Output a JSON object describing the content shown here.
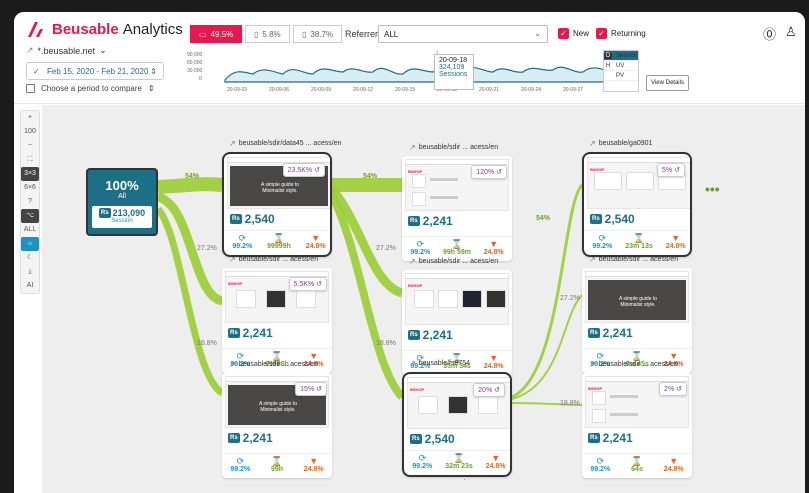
{
  "app": {
    "brand": "Beusable",
    "title": "Analytics"
  },
  "domain": "*.beusable.net",
  "date_range": "Feb 15, 2020 - Feb 21, 2020",
  "compare_label": "Choose a period to compare",
  "devices": [
    {
      "label": "49.5%",
      "active": true
    },
    {
      "label": "5.8%",
      "active": false
    },
    {
      "label": "38.7%",
      "active": false
    }
  ],
  "referrer": {
    "label": "Referrer",
    "value": "ALL"
  },
  "visitor_filters": [
    {
      "label": "New",
      "checked": true
    },
    {
      "label": "Returning",
      "checked": true
    }
  ],
  "spark": {
    "yticks": [
      "90,000",
      "60,000",
      "30,000",
      "0"
    ],
    "xticks": [
      "20-09-03",
      "20-09-06",
      "20-09-09",
      "20-09-12",
      "20-09-15",
      "20-09-18",
      "20-09-21",
      "20-09-24",
      "20-09-27",
      "20-09-30"
    ],
    "tooltip": {
      "date": "20-09-18",
      "value": "324,109",
      "metric": "Sessions"
    }
  },
  "session_menu": [
    {
      "key": "D",
      "label": "Session",
      "active": true
    },
    {
      "key": "H",
      "label": "UV",
      "active": false
    },
    {
      "key": "",
      "label": "PV",
      "active": false
    }
  ],
  "view_details": "View Details",
  "toolbar": [
    "+",
    "100",
    "−",
    "⛶",
    "3×3",
    "6×6",
    "?",
    "⌥",
    "ALL",
    "☼",
    "☾",
    "⤓",
    "AI"
  ],
  "root": {
    "percent": "100%",
    "label": "All",
    "badge": "Rs",
    "sessions": "213,090",
    "sessions_label": "Session"
  },
  "cards": [
    {
      "title": "beusable/sdir/data45 ... acess/en",
      "returns": "23.5K%",
      "value": "2,540",
      "m1": "99.2%",
      "m2": "99999h",
      "m3": "24.8%",
      "variant": "hero"
    },
    {
      "title": "beusable/sdir ... acess/en",
      "returns": "5.5K%",
      "value": "2,241",
      "m1": "99.2%",
      "m2": "99998h",
      "m3": "24.8%",
      "variant": "products"
    },
    {
      "title": "beusable/sdir ... acess/en",
      "returns": "15%",
      "value": "2,241",
      "m1": "99.2%",
      "m2": "99h",
      "m3": "24.8%",
      "variant": "hero"
    },
    {
      "title": "beusable/sdir ... acess/en",
      "returns": "120%",
      "value": "2,241",
      "m1": "99.2%",
      "m2": "99h 59m",
      "m3": "24.8%",
      "variant": "list"
    },
    {
      "title": "beusable/sdir ... acess/en",
      "returns": "",
      "value": "2,241",
      "m1": "99.2%",
      "m2": "35m 34s",
      "m3": "24.8%",
      "variant": "chairs"
    },
    {
      "title": "beusable/fs8754",
      "returns": "20%",
      "value": "2,540",
      "m1": "99.2%",
      "m2": "32m 23s",
      "m3": "24.8%",
      "variant": "products"
    },
    {
      "title": "beusable/ga0901",
      "returns": "5%",
      "value": "2,540",
      "m1": "99.2%",
      "m2": "23m 13s",
      "m3": "24.8%",
      "variant": "tables"
    },
    {
      "title": "beusable/sdir ... acess/en",
      "returns": "",
      "value": "2,241",
      "m1": "99.2%",
      "m2": "8m 45s",
      "m3": "24.8%",
      "variant": "hero"
    },
    {
      "title": "beusable/sdir ... acess/en",
      "returns": "2%",
      "value": "2,241",
      "m1": "99.2%",
      "m2": "64s",
      "m3": "24.8%",
      "variant": "list"
    }
  ],
  "hero_text": "A simple guide to Minimalist style.",
  "shop_label": "BSHOP",
  "flow_percents": [
    "54%",
    "27.2%",
    "18.8%",
    "54%",
    "27.2%",
    "18.8%",
    "54%",
    "27.2%",
    "18.8%"
  ],
  "colors": {
    "brand": "#e8174d",
    "teal": "#1d6f86",
    "green": "#6aa32b",
    "flow": "#9acd32",
    "orange": "#e8641b",
    "blue": "#1d94c0"
  }
}
